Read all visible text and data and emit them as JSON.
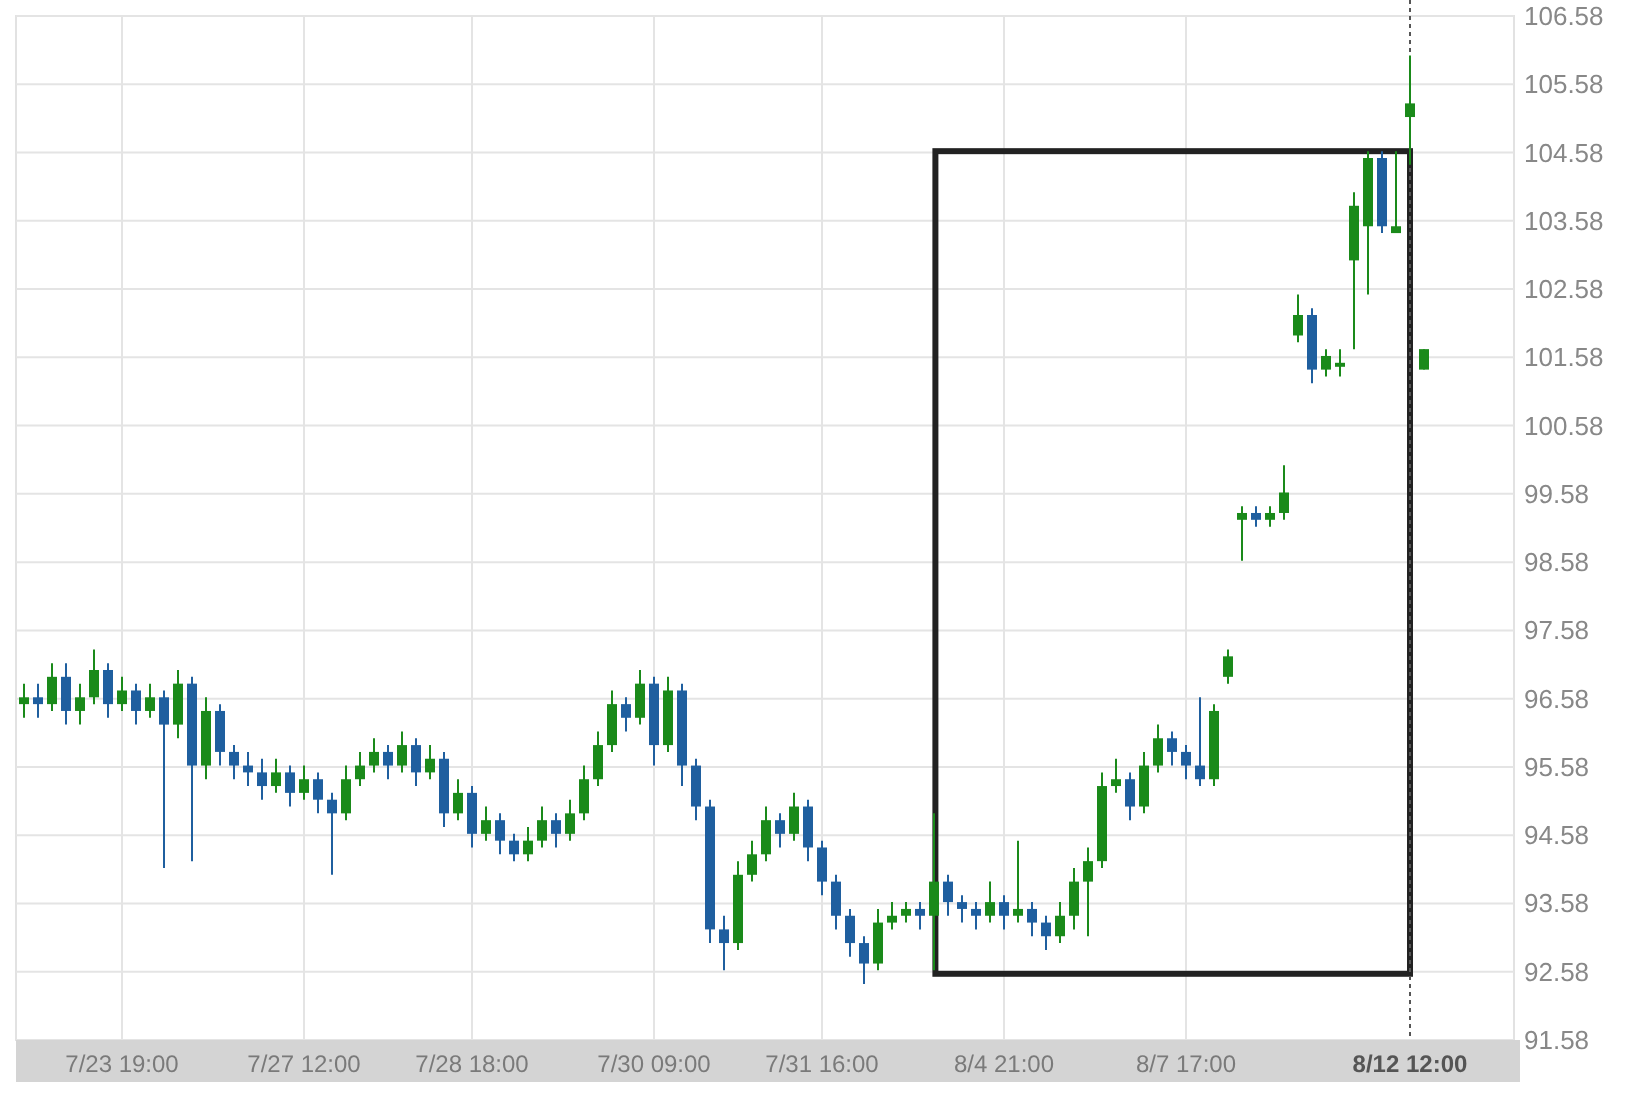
{
  "chart": {
    "chart_data": {
      "type": "candlestick",
      "grid": true,
      "categories": [
        null,
        null,
        null,
        null,
        null,
        null,
        null,
        "7/23 19:00",
        null,
        null,
        null,
        null,
        null,
        null,
        null,
        null,
        null,
        null,
        null,
        null,
        "7/27 12:00",
        null,
        null,
        null,
        null,
        null,
        null,
        null,
        null,
        null,
        null,
        null,
        "7/28 18:00",
        null,
        null,
        null,
        null,
        null,
        null,
        null,
        null,
        null,
        null,
        null,
        null,
        "7/30 09:00",
        null,
        null,
        null,
        null,
        null,
        null,
        null,
        null,
        null,
        null,
        null,
        "7/31 16:00",
        null,
        null,
        null,
        null,
        null,
        null,
        null,
        null,
        null,
        null,
        null,
        null,
        "8/4 21:00",
        null,
        null,
        null,
        null,
        null,
        null,
        null,
        null,
        null,
        null,
        null,
        null,
        "8/7 17:00",
        null,
        null,
        null,
        null,
        null,
        null,
        null,
        null,
        null,
        null,
        null,
        null,
        null,
        null,
        null,
        "8/12 12:00",
        null
      ],
      "ohlc": [
        [
          96.5,
          96.8,
          96.3,
          96.6
        ],
        [
          96.6,
          96.8,
          96.3,
          96.5
        ],
        [
          96.5,
          97.1,
          96.4,
          96.9
        ],
        [
          96.9,
          97.1,
          96.2,
          96.4
        ],
        [
          96.4,
          96.8,
          96.2,
          96.6
        ],
        [
          96.6,
          97.3,
          96.5,
          97.0
        ],
        [
          97.0,
          97.1,
          96.3,
          96.5
        ],
        [
          96.5,
          96.9,
          96.4,
          96.7
        ],
        [
          96.7,
          96.8,
          96.2,
          96.4
        ],
        [
          96.4,
          96.8,
          96.3,
          96.6
        ],
        [
          96.6,
          96.7,
          94.1,
          96.2
        ],
        [
          96.2,
          97.0,
          96.0,
          96.8
        ],
        [
          96.8,
          96.9,
          94.2,
          95.6
        ],
        [
          95.6,
          96.6,
          95.4,
          96.4
        ],
        [
          96.4,
          96.5,
          95.6,
          95.8
        ],
        [
          95.8,
          95.9,
          95.4,
          95.6
        ],
        [
          95.6,
          95.8,
          95.3,
          95.5
        ],
        [
          95.5,
          95.7,
          95.1,
          95.3
        ],
        [
          95.3,
          95.7,
          95.2,
          95.5
        ],
        [
          95.5,
          95.6,
          95.0,
          95.2
        ],
        [
          95.2,
          95.6,
          95.1,
          95.4
        ],
        [
          95.4,
          95.5,
          94.9,
          95.1
        ],
        [
          95.1,
          95.2,
          94.0,
          94.9
        ],
        [
          94.9,
          95.6,
          94.8,
          95.4
        ],
        [
          95.4,
          95.8,
          95.3,
          95.6
        ],
        [
          95.6,
          96.0,
          95.5,
          95.8
        ],
        [
          95.8,
          95.9,
          95.4,
          95.6
        ],
        [
          95.6,
          96.1,
          95.5,
          95.9
        ],
        [
          95.9,
          96.0,
          95.3,
          95.5
        ],
        [
          95.5,
          95.9,
          95.4,
          95.7
        ],
        [
          95.7,
          95.8,
          94.7,
          94.9
        ],
        [
          94.9,
          95.4,
          94.8,
          95.2
        ],
        [
          95.2,
          95.3,
          94.4,
          94.6
        ],
        [
          94.6,
          95.0,
          94.5,
          94.8
        ],
        [
          94.8,
          94.9,
          94.3,
          94.5
        ],
        [
          94.5,
          94.6,
          94.2,
          94.3
        ],
        [
          94.3,
          94.7,
          94.2,
          94.5
        ],
        [
          94.5,
          95.0,
          94.4,
          94.8
        ],
        [
          94.8,
          94.9,
          94.4,
          94.6
        ],
        [
          94.6,
          95.1,
          94.5,
          94.9
        ],
        [
          94.9,
          95.6,
          94.8,
          95.4
        ],
        [
          95.4,
          96.1,
          95.3,
          95.9
        ],
        [
          95.9,
          96.7,
          95.8,
          96.5
        ],
        [
          96.5,
          96.6,
          96.1,
          96.3
        ],
        [
          96.3,
          97.0,
          96.2,
          96.8
        ],
        [
          96.8,
          96.9,
          95.6,
          95.9
        ],
        [
          95.9,
          96.9,
          95.8,
          96.7
        ],
        [
          96.7,
          96.8,
          95.3,
          95.6
        ],
        [
          95.6,
          95.7,
          94.8,
          95.0
        ],
        [
          95.0,
          95.1,
          93.0,
          93.2
        ],
        [
          93.2,
          93.4,
          92.6,
          93.0
        ],
        [
          93.0,
          94.2,
          92.9,
          94.0
        ],
        [
          94.0,
          94.5,
          93.9,
          94.3
        ],
        [
          94.3,
          95.0,
          94.2,
          94.8
        ],
        [
          94.8,
          94.9,
          94.4,
          94.6
        ],
        [
          94.6,
          95.2,
          94.5,
          95.0
        ],
        [
          95.0,
          95.1,
          94.2,
          94.4
        ],
        [
          94.4,
          94.5,
          93.7,
          93.9
        ],
        [
          93.9,
          94.0,
          93.2,
          93.4
        ],
        [
          93.4,
          93.5,
          92.8,
          93.0
        ],
        [
          93.0,
          93.1,
          92.4,
          92.7
        ],
        [
          92.7,
          93.5,
          92.6,
          93.3
        ],
        [
          93.3,
          93.6,
          93.2,
          93.4
        ],
        [
          93.4,
          93.6,
          93.3,
          93.5
        ],
        [
          93.5,
          93.6,
          93.2,
          93.4
        ],
        [
          93.4,
          94.9,
          92.6,
          93.9
        ],
        [
          93.9,
          94.0,
          93.4,
          93.6
        ],
        [
          93.6,
          93.7,
          93.3,
          93.5
        ],
        [
          93.5,
          93.6,
          93.2,
          93.4
        ],
        [
          93.4,
          93.9,
          93.3,
          93.6
        ],
        [
          93.6,
          93.7,
          93.2,
          93.4
        ],
        [
          93.4,
          94.5,
          93.3,
          93.5
        ],
        [
          93.5,
          93.6,
          93.1,
          93.3
        ],
        [
          93.3,
          93.4,
          92.9,
          93.1
        ],
        [
          93.1,
          93.6,
          93.0,
          93.4
        ],
        [
          93.4,
          94.1,
          93.2,
          93.9
        ],
        [
          93.9,
          94.4,
          93.1,
          94.2
        ],
        [
          94.2,
          95.5,
          94.1,
          95.3
        ],
        [
          95.3,
          95.7,
          95.2,
          95.4
        ],
        [
          95.4,
          95.5,
          94.8,
          95.0
        ],
        [
          95.0,
          95.8,
          94.9,
          95.6
        ],
        [
          95.6,
          96.2,
          95.5,
          96.0
        ],
        [
          96.0,
          96.1,
          95.6,
          95.8
        ],
        [
          95.8,
          95.9,
          95.4,
          95.6
        ],
        [
          95.6,
          96.6,
          95.3,
          95.4
        ],
        [
          95.4,
          96.5,
          95.3,
          96.4
        ],
        [
          96.9,
          97.3,
          96.8,
          97.2
        ],
        [
          99.2,
          99.4,
          98.6,
          99.3
        ],
        [
          99.3,
          99.4,
          99.1,
          99.2
        ],
        [
          99.2,
          99.4,
          99.1,
          99.3
        ],
        [
          99.3,
          100.0,
          99.2,
          99.6
        ],
        [
          101.9,
          102.5,
          101.8,
          102.2
        ],
        [
          102.2,
          102.3,
          101.2,
          101.4
        ],
        [
          101.4,
          101.7,
          101.3,
          101.6
        ],
        [
          101.5,
          101.7,
          101.3,
          101.5
        ],
        [
          103.0,
          104.0,
          101.7,
          103.8
        ],
        [
          103.5,
          104.6,
          102.5,
          104.5
        ],
        [
          104.5,
          104.6,
          103.4,
          103.5
        ],
        [
          103.4,
          104.6,
          103.4,
          103.5
        ],
        [
          105.1,
          106.0,
          104.4,
          105.3
        ],
        [
          101.4,
          101.7,
          101.4,
          101.7
        ]
      ],
      "ylim": [
        91.58,
        106.58
      ],
      "yticks": [
        106.58,
        105.58,
        104.58,
        103.58,
        102.58,
        101.58,
        100.58,
        99.58,
        98.58,
        97.58,
        96.58,
        95.58,
        94.58,
        93.58,
        92.58,
        91.58
      ]
    }
  }
}
